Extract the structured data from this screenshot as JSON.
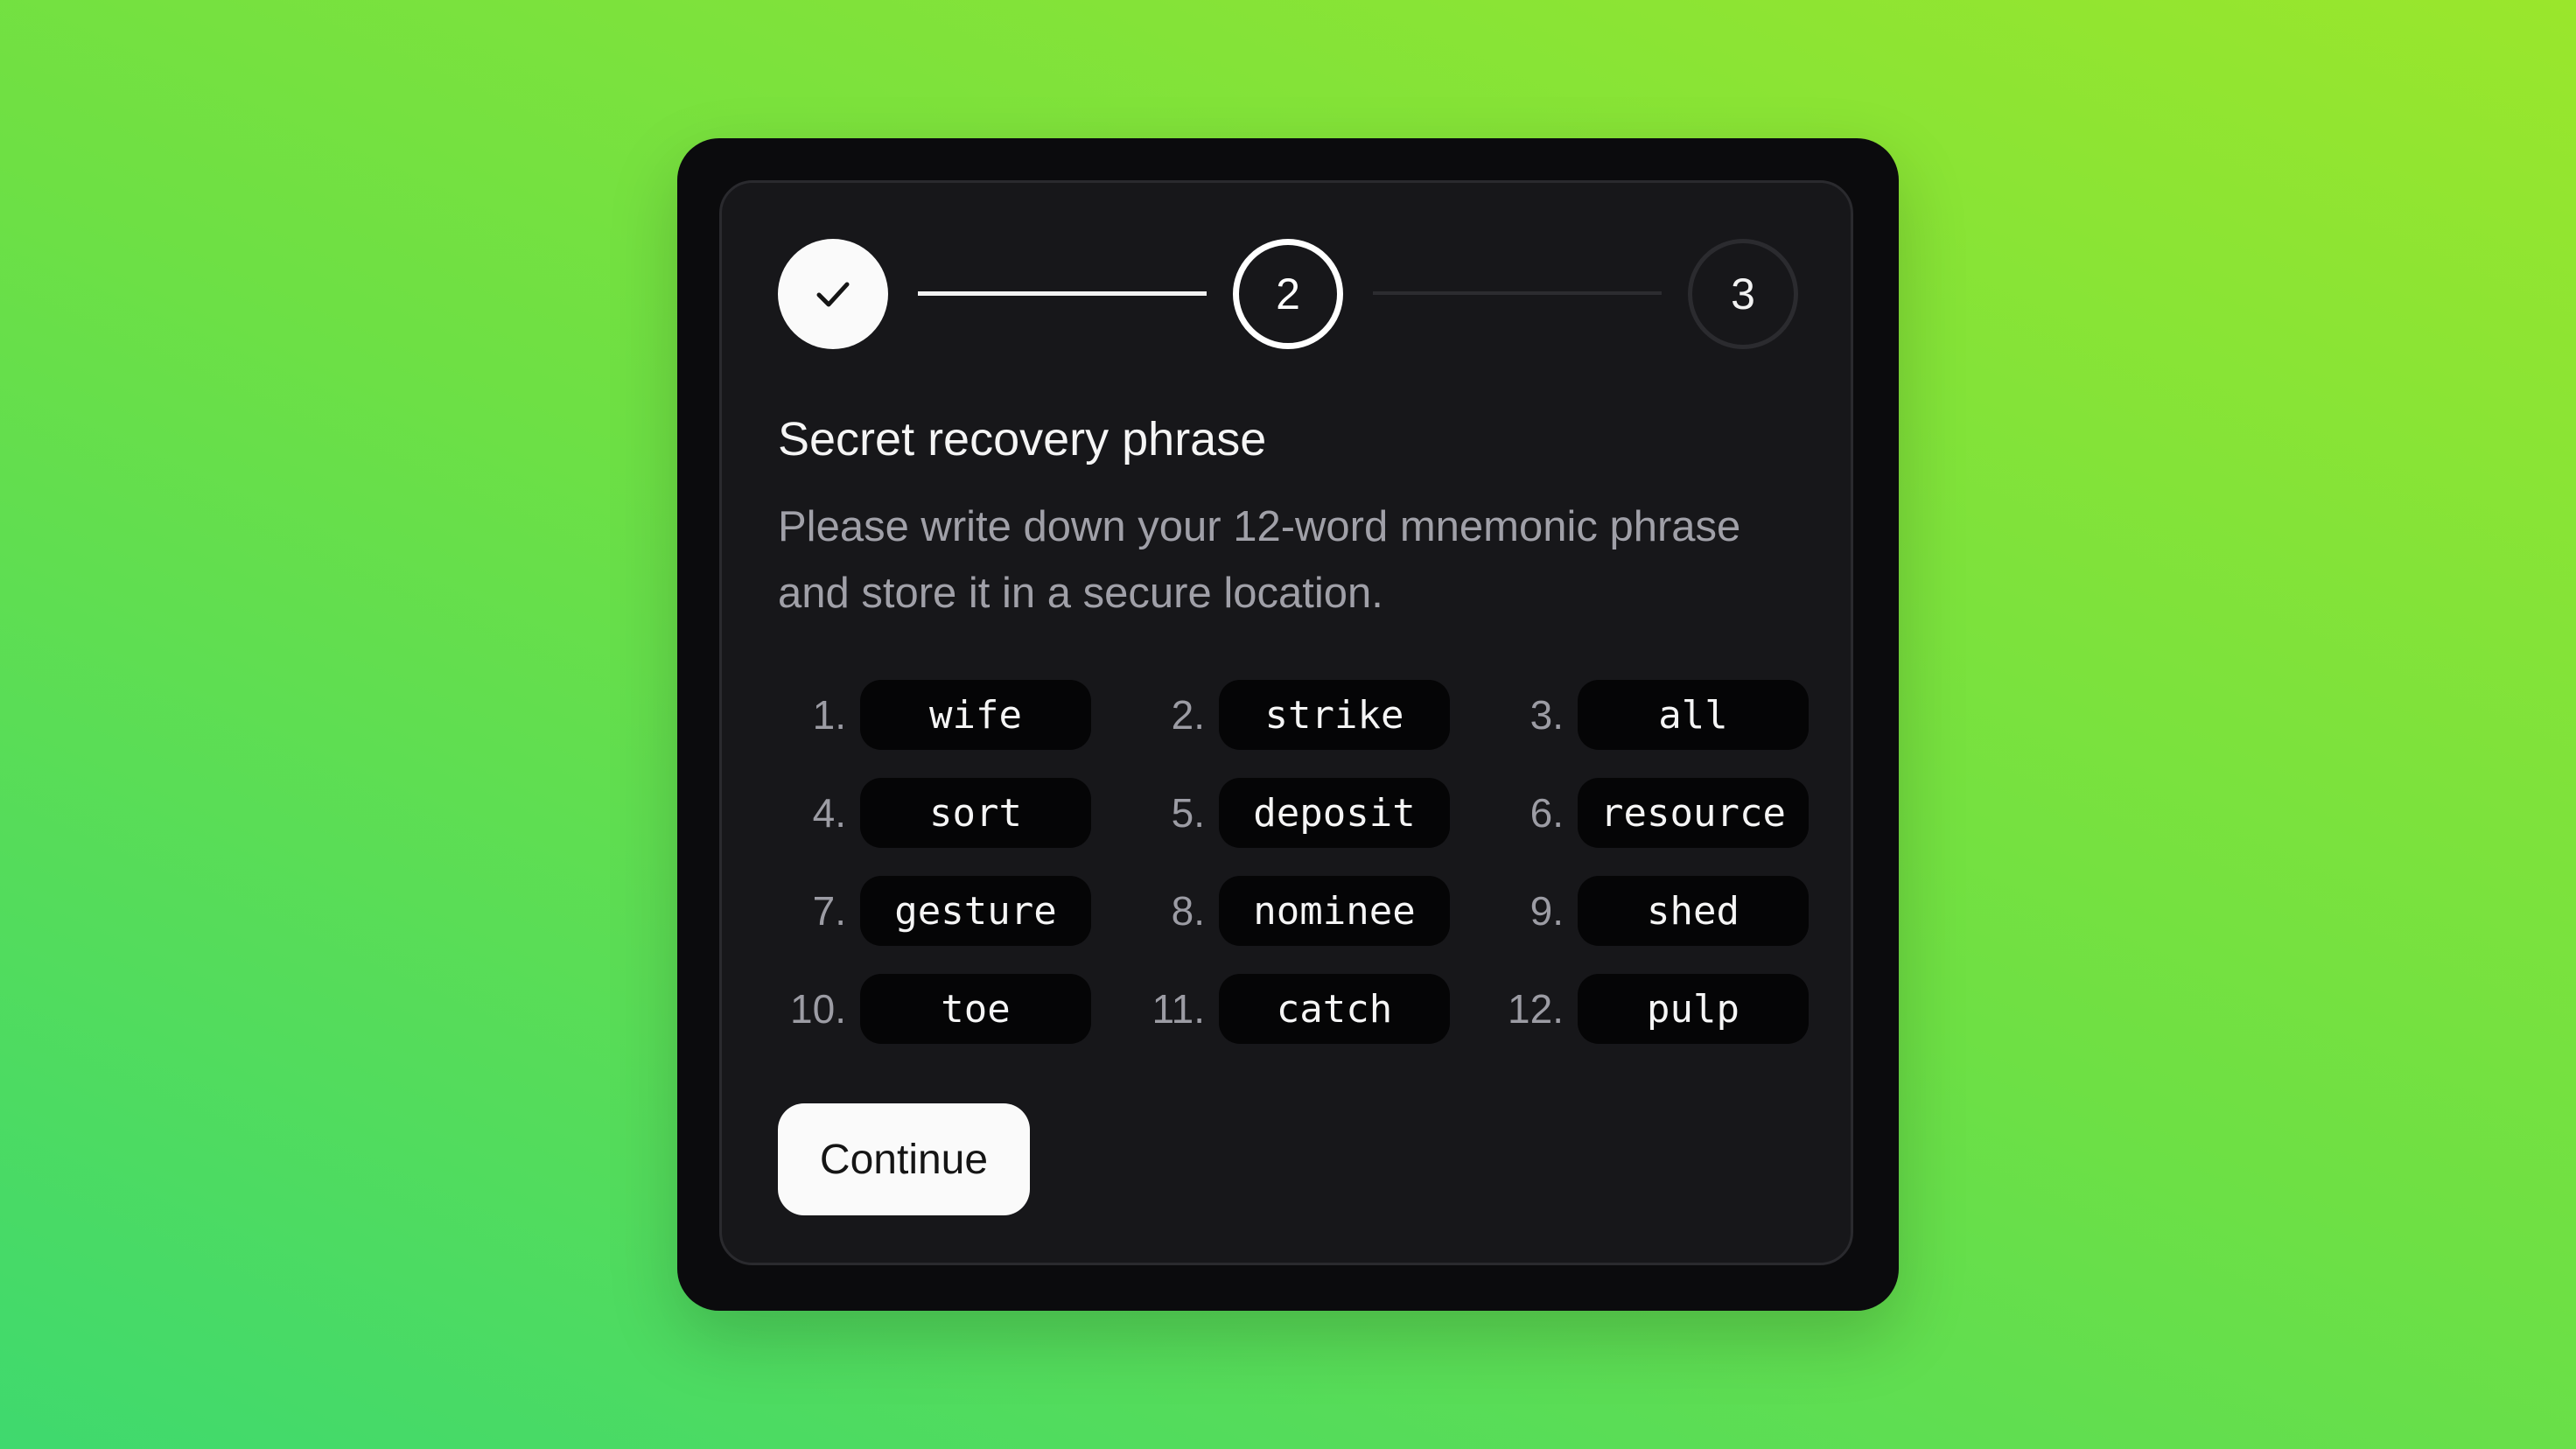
{
  "stepper": {
    "steps": [
      {
        "state": "completed",
        "icon": "check-icon",
        "label": ""
      },
      {
        "state": "active",
        "label": "2"
      },
      {
        "state": "upcoming",
        "label": "3"
      }
    ]
  },
  "heading": {
    "title": "Secret recovery phrase",
    "description": "Please write down your 12-word mnemonic phrase and store it in a secure location."
  },
  "phrase": {
    "words": [
      {
        "index": "1.",
        "word": "wife"
      },
      {
        "index": "2.",
        "word": "strike"
      },
      {
        "index": "3.",
        "word": "all"
      },
      {
        "index": "4.",
        "word": "sort"
      },
      {
        "index": "5.",
        "word": "deposit"
      },
      {
        "index": "6.",
        "word": "resource"
      },
      {
        "index": "7.",
        "word": "gesture"
      },
      {
        "index": "8.",
        "word": "nominee"
      },
      {
        "index": "9.",
        "word": "shed"
      },
      {
        "index": "10.",
        "word": "toe"
      },
      {
        "index": "11.",
        "word": "catch"
      },
      {
        "index": "12.",
        "word": "pulp"
      }
    ]
  },
  "actions": {
    "continue_label": "Continue"
  },
  "colors": {
    "background_start": "#3fd96e",
    "background_end": "#9ae62c",
    "card": "#17171a",
    "word_chip": "#050506",
    "primary_button": "#fafafa"
  }
}
